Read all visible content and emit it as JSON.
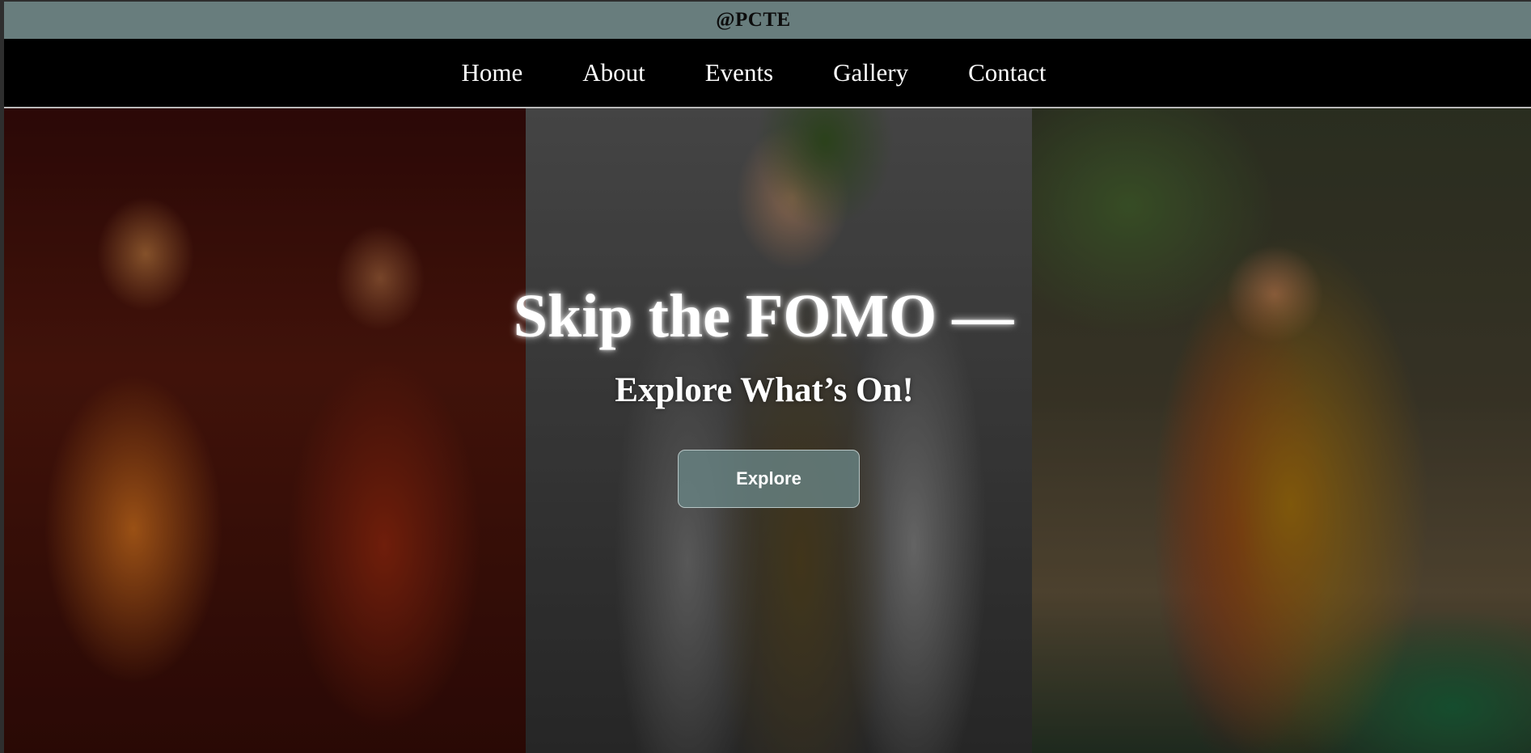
{
  "header": {
    "brand": "@PCTE"
  },
  "nav": {
    "items": [
      {
        "label": "Home"
      },
      {
        "label": "About"
      },
      {
        "label": "Events"
      },
      {
        "label": "Gallery"
      },
      {
        "label": "Contact"
      }
    ]
  },
  "hero": {
    "title": "Skip the FOMO —",
    "subtitle": "Explore What’s On!",
    "button_label": "Explore",
    "images": [
      "dancers-in-sarees-photo",
      "man-in-turban-photo",
      "bhangra-dancer-photo"
    ]
  },
  "colors": {
    "topbar": "#687d7d",
    "navbar": "#000000",
    "button": "#688282",
    "text": "#ffffff"
  }
}
